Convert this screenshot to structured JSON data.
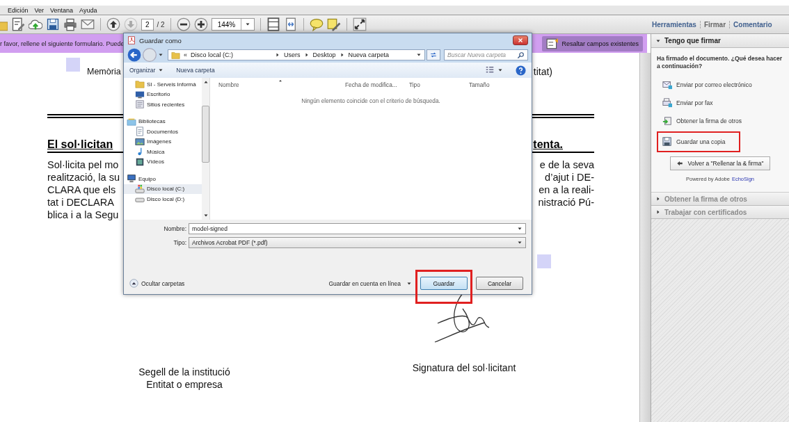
{
  "menu": [
    {
      "label": "Edición"
    },
    {
      "label": "Ver"
    },
    {
      "label": "Ventana"
    },
    {
      "label": "Ayuda"
    }
  ],
  "toolbar": {
    "page_current": "2",
    "page_total": "/ 2",
    "next_page": {
      "disabled": true
    },
    "zoom": "144%"
  },
  "tabs": [
    {
      "label": "Herramientas",
      "selected": false
    },
    {
      "label": "Firmar",
      "selected": true
    },
    {
      "label": "Comentario",
      "selected": false
    }
  ],
  "form_bar": {
    "notice": "r favor, rellene el siguiente formulario. Puede",
    "highlight_button": "Resaltar campos existentes"
  },
  "document": {
    "top_row": {
      "left": "Memòria",
      "right": "titat)"
    },
    "heading": {
      "left": "El sol·licitan",
      "right": "tenta."
    },
    "paragraph": [
      {
        "left": "Sol·licita pel mo",
        "right": "e de la seva"
      },
      {
        "left": "realització, la su",
        "right": "d’ajut i DE-"
      },
      {
        "left": "CLARA que els",
        "right": "en a la reali-"
      },
      {
        "left": "tat i DECLARA",
        "right": "nistració Pú-"
      },
      {
        "left": "blica i a la Segu"
      }
    ],
    "stamp_label": [
      "Segell de la institució",
      "Entitat o empresa"
    ],
    "signature_label": "Signatura del sol·licitant"
  },
  "side_panel": {
    "section": {
      "title": "Tengo que firmar",
      "expanded": true
    },
    "message": "Ha firmado el documento. ¿Qué desea hacer a continuación?",
    "actions": [
      {
        "kind": "email",
        "label": "Enviar por correo electrónico",
        "highlighted": false
      },
      {
        "kind": "fax",
        "label": "Enviar por fax",
        "highlighted": false
      },
      {
        "kind": "sign",
        "label": "Obtener la firma de otros",
        "highlighted": false
      },
      {
        "kind": "save",
        "label": "Guardar una copia",
        "highlighted": true
      }
    ],
    "back_button": "Volver a \"Rellenar la & firma\"",
    "powered_by": "Powered by Adobe",
    "brand": "EchoSign",
    "collapsed_sections": [
      {
        "title": "Obtener la firma de otros",
        "expanded": false
      },
      {
        "title": "Trabajar con certificados",
        "expanded": false
      }
    ]
  },
  "dialog": {
    "title": "Guardar como",
    "overflow_mark": "«",
    "breadcrumb": [
      "Disco local (C:)",
      "Users",
      "Desktop",
      "Nueva carpeta"
    ],
    "search": {
      "placeholder": "Buscar Nueva carpeta"
    },
    "commands": [
      "Organizar",
      "Nueva carpeta"
    ],
    "nav": [
      {
        "children": [
          {
            "kind": "folder",
            "label": "SI - Serveis Informà",
            "selected": false
          },
          {
            "kind": "desktop",
            "label": "Escritorio",
            "selected": false
          },
          {
            "kind": "recent",
            "label": "Sitios recientes",
            "selected": false
          }
        ]
      },
      {
        "kind": "library",
        "label": "Bibliotecas",
        "selected": false,
        "children": [
          {
            "kind": "documents",
            "label": "Documentos",
            "selected": false
          },
          {
            "kind": "pictures",
            "label": "Imágenes",
            "selected": false
          },
          {
            "kind": "music",
            "label": "Música",
            "selected": false
          },
          {
            "kind": "videos",
            "label": "Vídeos",
            "selected": false
          }
        ]
      },
      {
        "kind": "computer",
        "label": "Equipo",
        "selected": false,
        "children": [
          {
            "kind": "drive-c",
            "label": "Disco local (C:)",
            "selected": true
          },
          {
            "kind": "drive",
            "label": "Disco local (D:)",
            "selected": false
          }
        ]
      }
    ],
    "columns": [
      "Nombre",
      "Fecha de modifica...",
      "Tipo",
      "Tamaño"
    ],
    "empty_message": "Ningún elemento coincide con el criterio de búsqueda.",
    "filename": {
      "label": "Nombre:",
      "value": "model-signed"
    },
    "filetype": {
      "label": "Tipo:",
      "value": "Archivos Acrobat PDF (*.pdf)"
    },
    "hide_folders": "Ocultar carpetas",
    "online_save": "Guardar en cuenta en línea",
    "buttons": [
      {
        "label": "Guardar",
        "highlighted": true
      },
      {
        "label": "Cancelar",
        "highlighted": false
      }
    ]
  }
}
